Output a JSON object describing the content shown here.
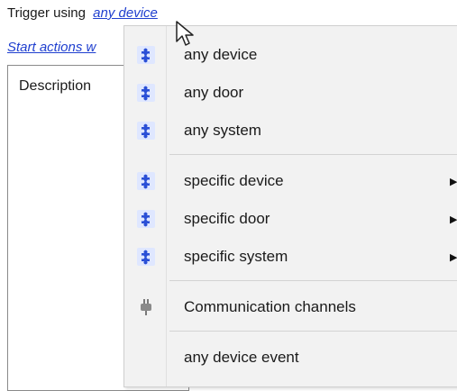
{
  "trigger": {
    "prefix": "Trigger using",
    "link": "any device"
  },
  "start_actions": {
    "text": "Start actions w"
  },
  "description": {
    "label": "Description"
  },
  "menu": {
    "items": [
      {
        "label": "any device",
        "icon": "puzzle-piece-icon"
      },
      {
        "label": "any door",
        "icon": "puzzle-piece-icon"
      },
      {
        "label": "any system",
        "icon": "puzzle-piece-icon"
      },
      {
        "label": "specific device",
        "icon": "puzzle-piece-icon",
        "submenu": "▶"
      },
      {
        "label": "specific door",
        "icon": "puzzle-piece-icon",
        "submenu": "▶"
      },
      {
        "label": "specific system",
        "icon": "puzzle-piece-icon",
        "submenu": "▶"
      },
      {
        "label": "Communication channels",
        "icon": "plug-icon"
      },
      {
        "label": "any device event"
      }
    ]
  },
  "colors": {
    "link": "#1f3fcf",
    "menu_background": "#f2f2f2",
    "icon_blue": "#2a4fd6"
  }
}
